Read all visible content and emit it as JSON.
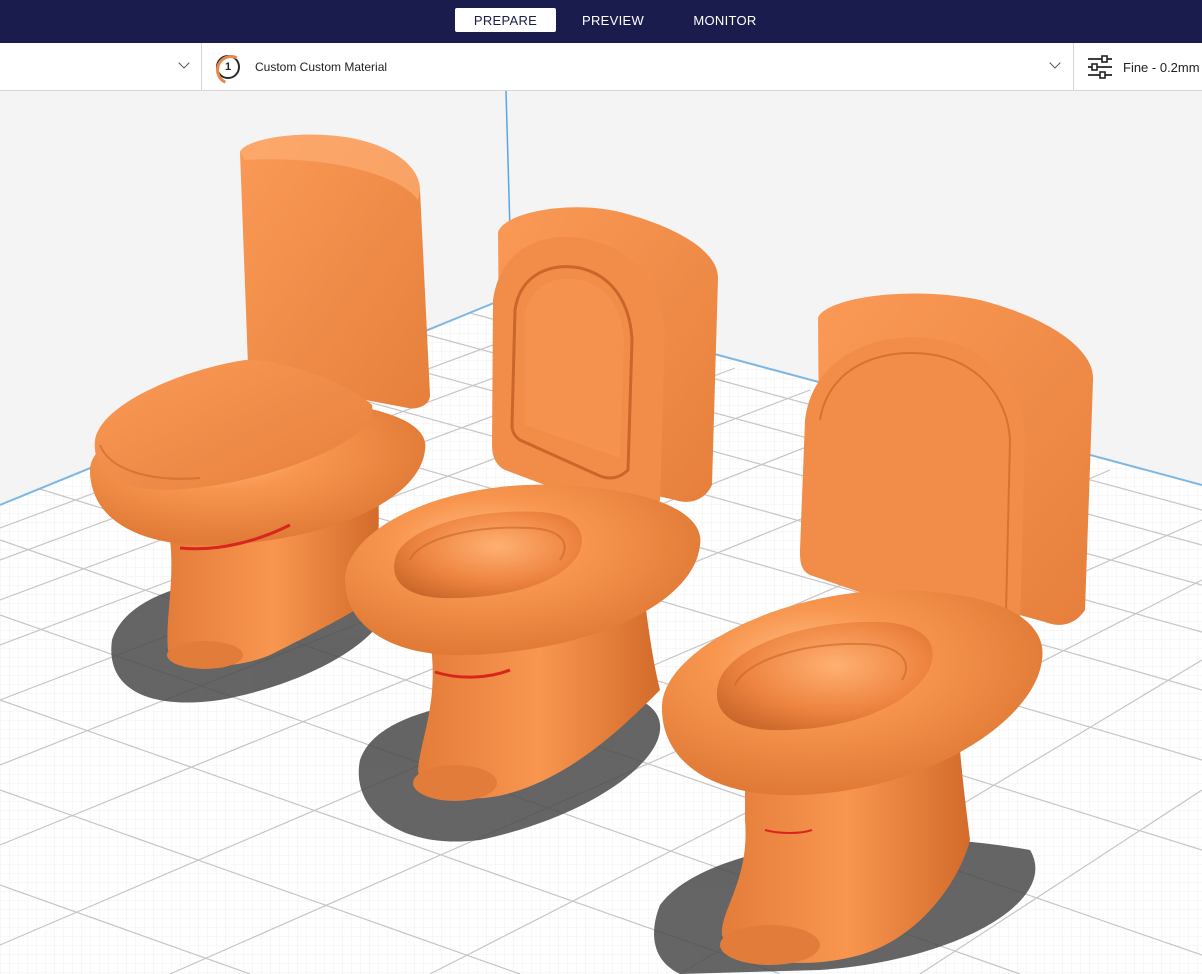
{
  "stages": {
    "prepare": "PREPARE",
    "preview": "PREVIEW",
    "monitor": "MONITOR",
    "active": "prepare"
  },
  "toolbar": {
    "printer_selector_value": "",
    "extruder_number": "1",
    "material_name": "Custom Custom Material",
    "print_profile": "Fine - 0.2mm"
  },
  "colors": {
    "header_bg": "#1a1c4e",
    "model_color": "#f5924e",
    "model_shadow": "#c5692c",
    "overhang_red": "#d8261e",
    "build_plate": "#ffffff",
    "grid_line": "#c9c9c9",
    "plate_edge": "#5aa6e0"
  },
  "viewport": {
    "objects": [
      "toilet-model-1",
      "toilet-model-2",
      "toilet-model-3"
    ]
  }
}
